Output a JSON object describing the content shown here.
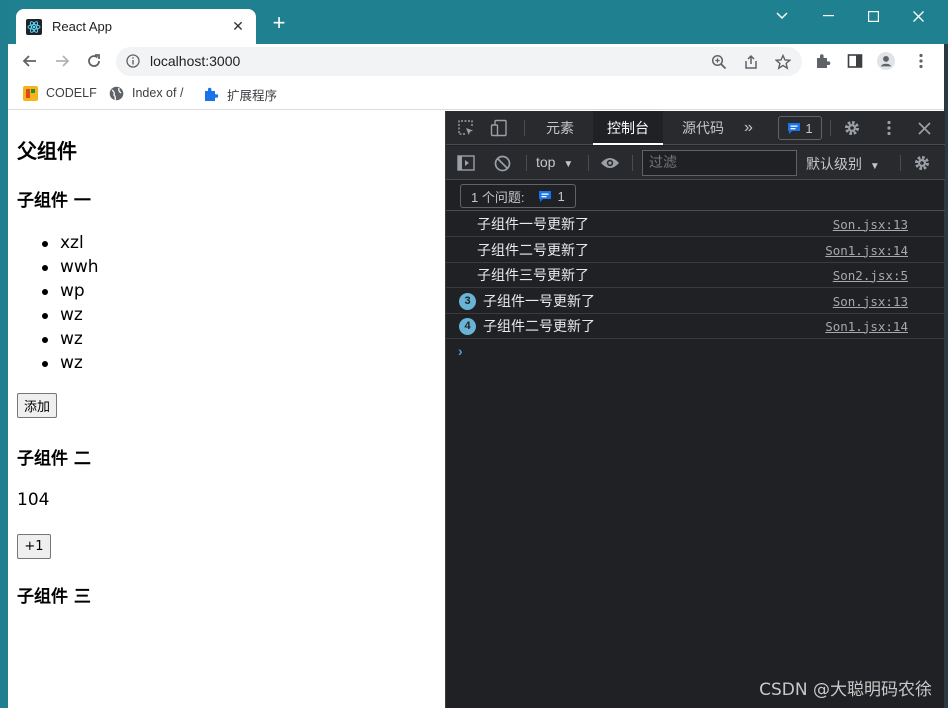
{
  "browser": {
    "tab_title": "React App",
    "tab_close": "✕",
    "new_tab": "+",
    "url": "localhost:3000",
    "bookmarks": [
      {
        "label": "CODELF",
        "icon": "codelf-icon"
      },
      {
        "label": "Index of /",
        "icon": "globe-icon"
      },
      {
        "label": "扩展程序",
        "icon": "puzzle-icon"
      }
    ]
  },
  "page": {
    "heading": "父组件",
    "child1": {
      "title": "子组件 一",
      "items": [
        "xzl",
        "wwh",
        "wp",
        "wz",
        "wz",
        "wz"
      ],
      "add_button": "添加"
    },
    "child2": {
      "title": "子组件 二",
      "count": "104",
      "inc_button": "+1"
    },
    "child3": {
      "title": "子组件 三"
    }
  },
  "devtools": {
    "tabs": [
      "元素",
      "控制台",
      "源代码"
    ],
    "active_tab": "控制台",
    "more": "»",
    "issues_count": "1",
    "context": "top",
    "filter_placeholder": "过滤",
    "level": "默认级别",
    "issues_label": "1 个问题:",
    "issues_badge_count": "1",
    "logs": [
      {
        "message": "子组件一号更新了",
        "source": "Son.jsx:13",
        "repeat": ""
      },
      {
        "message": "子组件二号更新了",
        "source": "Son1.jsx:14",
        "repeat": ""
      },
      {
        "message": "子组件三号更新了",
        "source": "Son2.jsx:5",
        "repeat": ""
      },
      {
        "message": "子组件一号更新了",
        "source": "Son.jsx:13",
        "repeat": "3"
      },
      {
        "message": "子组件二号更新了",
        "source": "Son1.jsx:14",
        "repeat": "4"
      }
    ],
    "prompt": "›"
  },
  "watermark": "CSDN @大聪明码农徐"
}
